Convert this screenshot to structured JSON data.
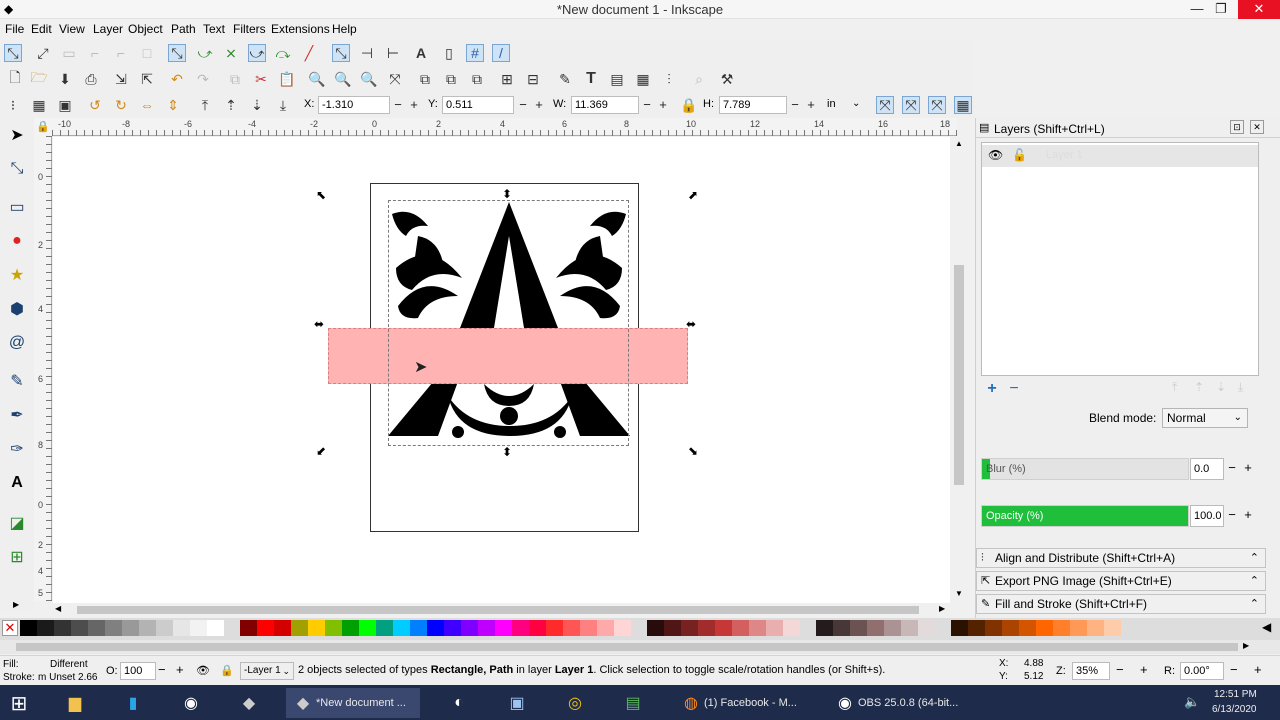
{
  "window": {
    "title": "*New document 1 - Inkscape",
    "minimize": "—",
    "maximize": "❐",
    "close": "✕"
  },
  "menu": [
    "File",
    "Edit",
    "View",
    "Layer",
    "Object",
    "Path",
    "Text",
    "Filters",
    "Extensions",
    "Help"
  ],
  "toolbar": {
    "x_label": "X:",
    "x_value": "-1.310",
    "y_label": "Y:",
    "y_value": "0.511",
    "w_label": "W:",
    "w_value": "11.369",
    "h_label": "H:",
    "h_value": "7.789",
    "unit": "in"
  },
  "ruler": {
    "h_ticks": [
      "-10",
      "-8",
      "-6",
      "-4",
      "-2",
      "0",
      "2",
      "4",
      "6",
      "8",
      "10",
      "12",
      "14",
      "16",
      "18"
    ],
    "v_ticks": [
      "0",
      "2",
      "4",
      "6",
      "8",
      "0",
      "2",
      "4",
      "5"
    ]
  },
  "layers_panel": {
    "title": "Layers (Shift+Ctrl+L)",
    "layer_name": "Layer 1",
    "add": "+",
    "remove": "−",
    "blend_label": "Blend mode:",
    "blend_value": "Normal",
    "blur_label": "Blur (%)",
    "blur_value": "0.0",
    "opacity_label": "Opacity (%)",
    "opacity_value": "100.0",
    "opacity_fraction": 1.0
  },
  "docked": [
    "Align and Distribute (Shift+Ctrl+A)",
    "Export PNG Image (Shift+Ctrl+E)",
    "Fill and Stroke (Shift+Ctrl+F)"
  ],
  "status": {
    "fill_label": "Fill:",
    "fill_value": "Different",
    "stroke_label": "Stroke:",
    "stroke_value": "m Unset 2.66",
    "o_label": "O:",
    "o_value": "100",
    "layer_value": "-Layer 1",
    "message_count": "2 objects selected of types",
    "message_types": "Rectangle, Path",
    "message_in": "in layer",
    "message_layer": "Layer 1",
    "message_tail": ". Click selection to toggle scale/rotation handles (or Shift+s).",
    "x_label": "X:",
    "x_value": "4.88",
    "y_label": "Y:",
    "y_value": "5.12",
    "z_label": "Z:",
    "zoom_value": "35%",
    "r_label": "R:",
    "rotation_value": "0.00°"
  },
  "taskbar": {
    "tasks": [
      "*New document ...",
      "(1) Facebook - M...",
      "OBS 25.0.8 (64-bit..."
    ],
    "time": "12:51 PM",
    "date": "6/13/2020"
  },
  "colors": {
    "selection_rect": "#ffb3b3",
    "opacity_bar": "#1fbf3c",
    "taskbar": "#1f2b4a"
  }
}
